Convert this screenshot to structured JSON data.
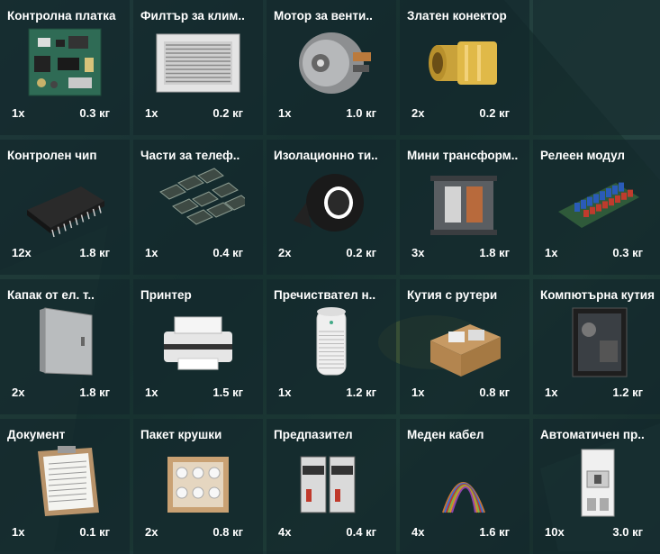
{
  "items": [
    {
      "name": "Контролна платка",
      "qty": "1x",
      "weight": "0.3 кг",
      "icon": "circuit-board-icon"
    },
    {
      "name": "Филтър за клим..",
      "qty": "1x",
      "weight": "0.2 кг",
      "icon": "air-filter-icon"
    },
    {
      "name": "Мотор за венти..",
      "qty": "1x",
      "weight": "1.0 кг",
      "icon": "fan-motor-icon"
    },
    {
      "name": "Златен конектор",
      "qty": "2x",
      "weight": "0.2 кг",
      "icon": "gold-connector-icon"
    },
    {
      "name": "Контролен чип",
      "qty": "12x",
      "weight": "1.8 кг",
      "icon": "chip-icon"
    },
    {
      "name": "Части за телеф..",
      "qty": "1x",
      "weight": "0.4 кг",
      "icon": "phone-parts-icon"
    },
    {
      "name": "Изолационно ти..",
      "qty": "2x",
      "weight": "0.2 кг",
      "icon": "tape-roll-icon"
    },
    {
      "name": "Мини трансформ..",
      "qty": "3x",
      "weight": "1.8 кг",
      "icon": "transformer-icon"
    },
    {
      "name": "Релеен модул",
      "qty": "1x",
      "weight": "0.3 кг",
      "icon": "relay-module-icon"
    },
    {
      "name": "Капак от ел. т..",
      "qty": "2x",
      "weight": "1.8 кг",
      "icon": "panel-cover-icon"
    },
    {
      "name": "Принтер",
      "qty": "1x",
      "weight": "1.5 кг",
      "icon": "printer-icon"
    },
    {
      "name": "Пречиствател н..",
      "qty": "1x",
      "weight": "1.2 кг",
      "icon": "air-purifier-icon"
    },
    {
      "name": "Кутия с рутери",
      "qty": "1x",
      "weight": "0.8 кг",
      "icon": "router-box-icon"
    },
    {
      "name": "Компютърна кутия",
      "qty": "1x",
      "weight": "1.2 кг",
      "icon": "pc-case-icon"
    },
    {
      "name": "Документ",
      "qty": "1x",
      "weight": "0.1 кг",
      "icon": "clipboard-document-icon"
    },
    {
      "name": "Пакет крушки",
      "qty": "2x",
      "weight": "0.8 кг",
      "icon": "bulb-box-icon"
    },
    {
      "name": "Предпазител",
      "qty": "4x",
      "weight": "0.4 кг",
      "icon": "fuse-icon"
    },
    {
      "name": "Меден кабел",
      "qty": "4x",
      "weight": "1.6 кг",
      "icon": "copper-cable-icon"
    },
    {
      "name": "Автоматичен пр..",
      "qty": "10x",
      "weight": "3.0 кг",
      "icon": "circuit-breaker-icon"
    }
  ]
}
